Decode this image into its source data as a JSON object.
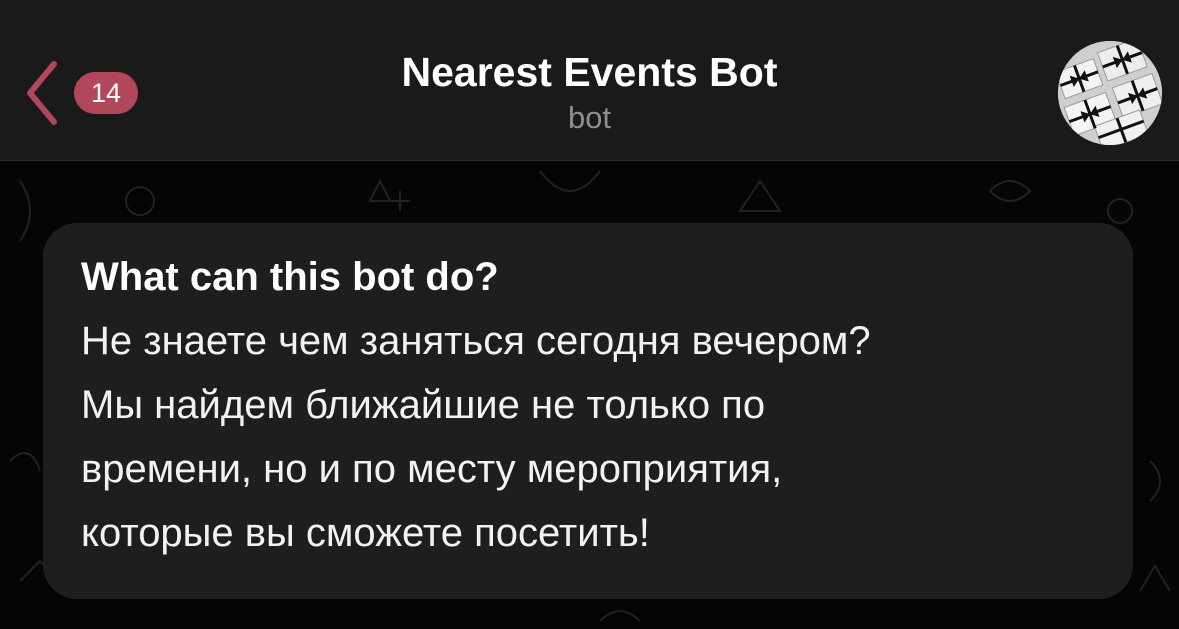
{
  "header": {
    "back_icon": "chevron-left-icon",
    "unread_count": "14",
    "title": "Nearest Events Bot",
    "subtitle": "bot",
    "accent_color": "#b2475c"
  },
  "bubble": {
    "heading": "What can this bot do?",
    "lines": [
      "Не знаете чем заняться сегодня вечером?",
      "Мы найдем ближайшие не только по",
      "времени, но и по месту мероприятия,",
      "которые вы сможете посетить!"
    ]
  }
}
